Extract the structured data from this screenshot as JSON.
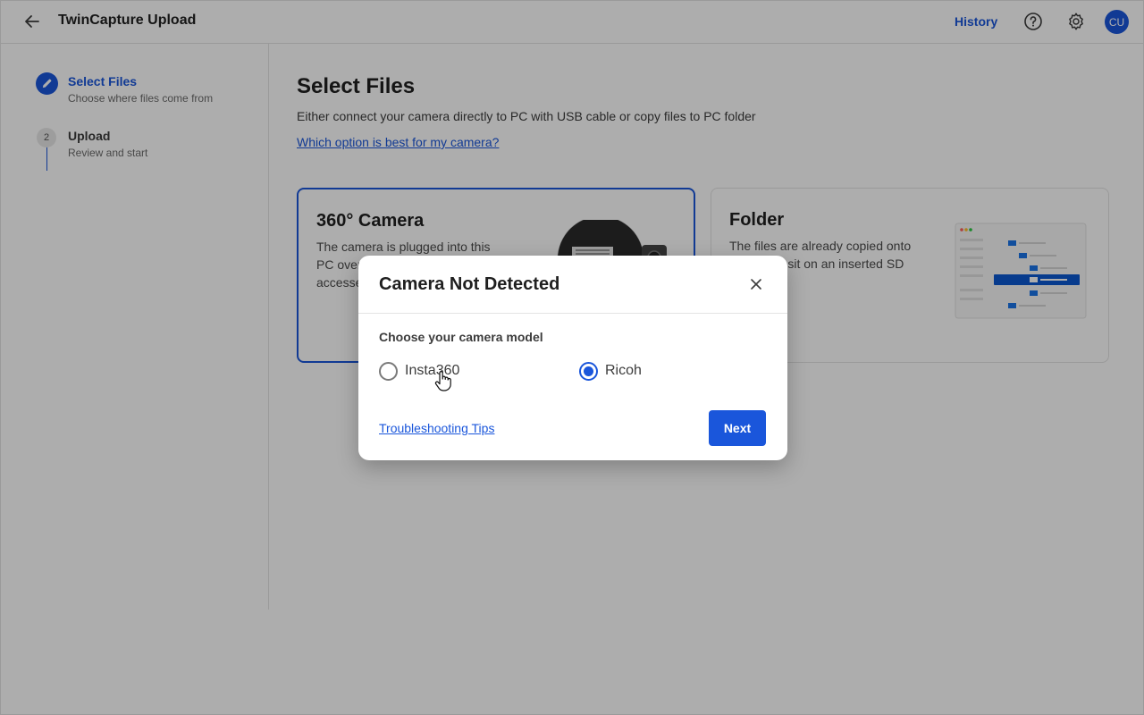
{
  "header": {
    "title": "TwinCapture Upload",
    "history_label": "History",
    "avatar_initials": "CU"
  },
  "sidebar": {
    "steps": [
      {
        "number": "",
        "title": "Select Files",
        "subtitle": "Choose where files come from",
        "state": "active"
      },
      {
        "number": "2",
        "title": "Upload",
        "subtitle": "Review and start",
        "state": "pending"
      }
    ]
  },
  "main": {
    "title": "Select Files",
    "description": "Either connect your camera directly to PC with USB cable or copy files to PC folder",
    "help_link": "Which option is best for my camera?",
    "cards": [
      {
        "title": "360° Camera",
        "description": "The camera is plugged into this PC over USB cable and can be accessed from it directly",
        "selected": true
      },
      {
        "title": "Folder",
        "description": "The files are already copied onto this PC or sit on an inserted SD card",
        "selected": false
      }
    ]
  },
  "modal": {
    "title": "Camera Not Detected",
    "label": "Choose your camera model",
    "options": [
      {
        "label": "Insta360",
        "selected": false
      },
      {
        "label": "Ricoh",
        "selected": true
      }
    ],
    "troubleshoot_link": "Troubleshooting Tips",
    "next_label": "Next"
  },
  "colors": {
    "accent": "#1a56db",
    "overlay": "rgba(0,0,0,0.32)"
  }
}
